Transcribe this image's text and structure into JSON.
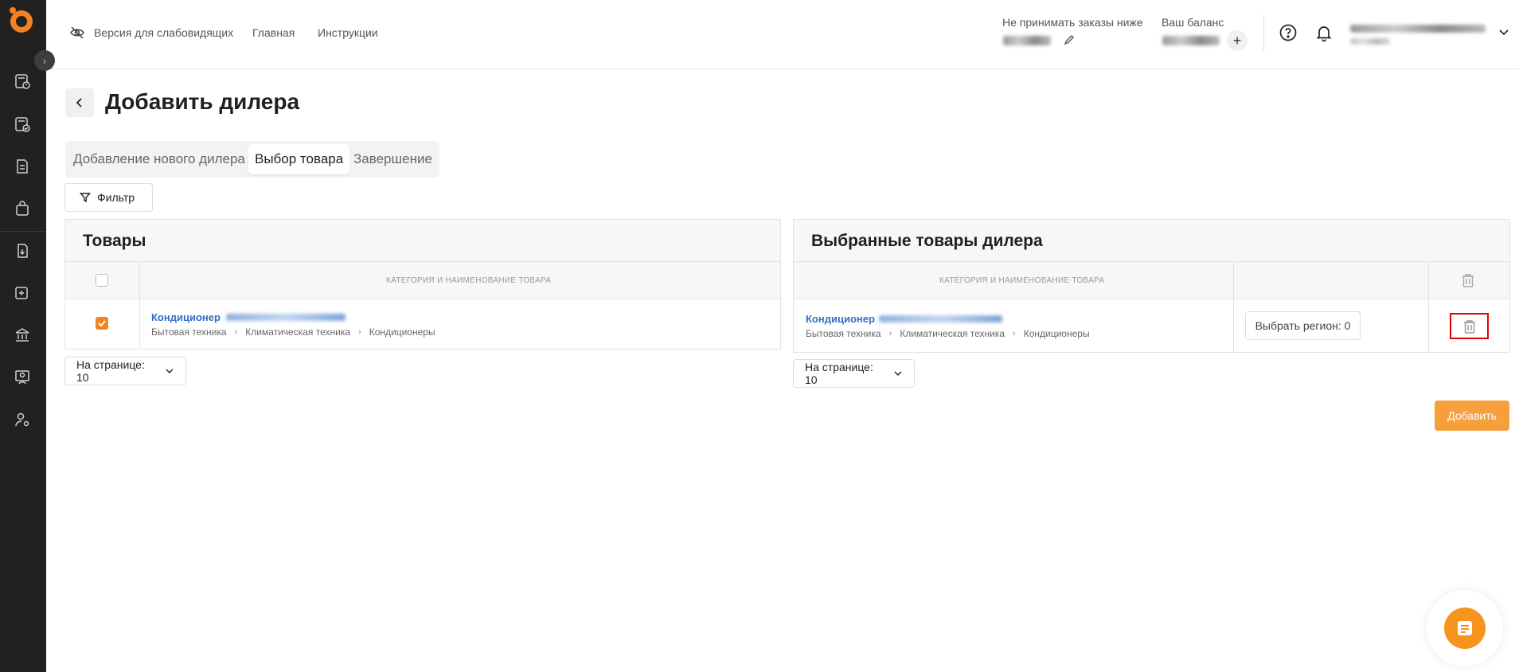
{
  "header": {
    "accessibility_link": "Версия для слабовидящих",
    "home_link": "Главная",
    "instructions_link": "Инструкции",
    "min_order_label": "Не принимать заказы ниже",
    "balance_label": "Ваш баланс"
  },
  "page": {
    "title": "Добавить дилера"
  },
  "tabs": [
    {
      "label": "Добавление нового дилера"
    },
    {
      "label": "Выбор товара"
    },
    {
      "label": "Завершение"
    }
  ],
  "filter": {
    "label": "Фильтр"
  },
  "products_panel": {
    "title": "Товары",
    "column_header": "Категория и наименование товара",
    "rows": [
      {
        "name": "Кондиционер",
        "checked": true,
        "breadcrumbs": [
          "Бытовая техника",
          "Климатическая техника",
          "Кондиционеры"
        ]
      }
    ],
    "per_page": "На странице: 10"
  },
  "selected_panel": {
    "title": "Выбранные товары дилера",
    "column_header": "Категория и наименование товара",
    "rows": [
      {
        "name": "Кондиционер",
        "breadcrumbs": [
          "Бытовая техника",
          "Климатическая техника",
          "Кондиционеры"
        ],
        "region_button": "Выбрать регион: 0"
      }
    ],
    "per_page": "На странице: 10"
  },
  "actions": {
    "add_label": "Добавить"
  },
  "colors": {
    "accent": "#f58220",
    "add_button": "#f5a03d",
    "link": "#2f6fc3",
    "sidebar": "#212121"
  }
}
